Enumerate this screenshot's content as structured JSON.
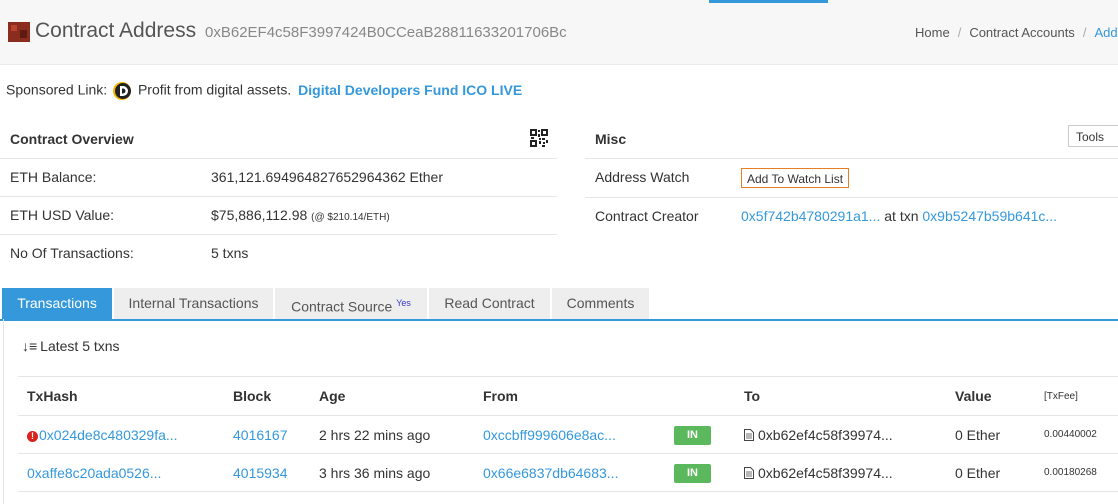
{
  "header": {
    "title": "Contract Address",
    "address": "0xB62EF4c58F3997424B0CCeaB28811633201706Bc",
    "breadcrumb": [
      "Home",
      "Contract Accounts",
      "Add"
    ]
  },
  "sponsor": {
    "label": "Sponsored Link:",
    "text": "Profit from digital assets.",
    "link": "Digital Developers Fund ICO LIVE"
  },
  "overview": {
    "title": "Contract Overview",
    "rows": [
      {
        "key": "ETH Balance:",
        "value": "361,121.694964827652964362 Ether"
      },
      {
        "key": "ETH USD Value:",
        "value": "$75,886,112.98",
        "note": "(@ $210.14/ETH)"
      },
      {
        "key": "No Of Transactions:",
        "value": "5 txns"
      }
    ]
  },
  "misc": {
    "title": "Misc",
    "tools_label": "Tools",
    "address_watch_label": "Address Watch",
    "watch_button": "Add To Watch List",
    "creator_label": "Contract Creator",
    "creator_address": "0x5f742b4780291a1...",
    "creator_at": "at txn",
    "creator_txn": "0x9b5247b59b641c..."
  },
  "tabs": [
    {
      "label": "Transactions",
      "active": true
    },
    {
      "label": "Internal Transactions",
      "active": false
    },
    {
      "label": "Contract Source",
      "badge": "Yes",
      "active": false
    },
    {
      "label": "Read Contract",
      "active": false
    },
    {
      "label": "Comments",
      "active": false
    }
  ],
  "transactions": {
    "sort_icon": "↓≡",
    "latest_label": "Latest 5 txns",
    "columns": [
      "TxHash",
      "Block",
      "Age",
      "From",
      "",
      "To",
      "Value",
      "[TxFee]"
    ],
    "rows": [
      {
        "error": true,
        "hash": "0x024de8c480329fa...",
        "block": "4016167",
        "age": "2 hrs 22 mins ago",
        "from": "0xccbff999606e8ac...",
        "direction": "IN",
        "to": "0xb62ef4c58f39974...",
        "value": "0 Ether",
        "fee": "0.00440002"
      },
      {
        "error": false,
        "hash": "0xaffe8c20ada0526...",
        "block": "4015934",
        "age": "3 hrs 36 mins ago",
        "from": "0x66e6837db64683...",
        "direction": "IN",
        "to": "0xb62ef4c58f39974...",
        "value": "0 Ether",
        "fee": "0.00180268"
      }
    ]
  },
  "colors": {
    "accent": "#3498db",
    "in_badge": "#5cb85c",
    "error": "#d9211e",
    "watch_border": "#e67e22"
  }
}
